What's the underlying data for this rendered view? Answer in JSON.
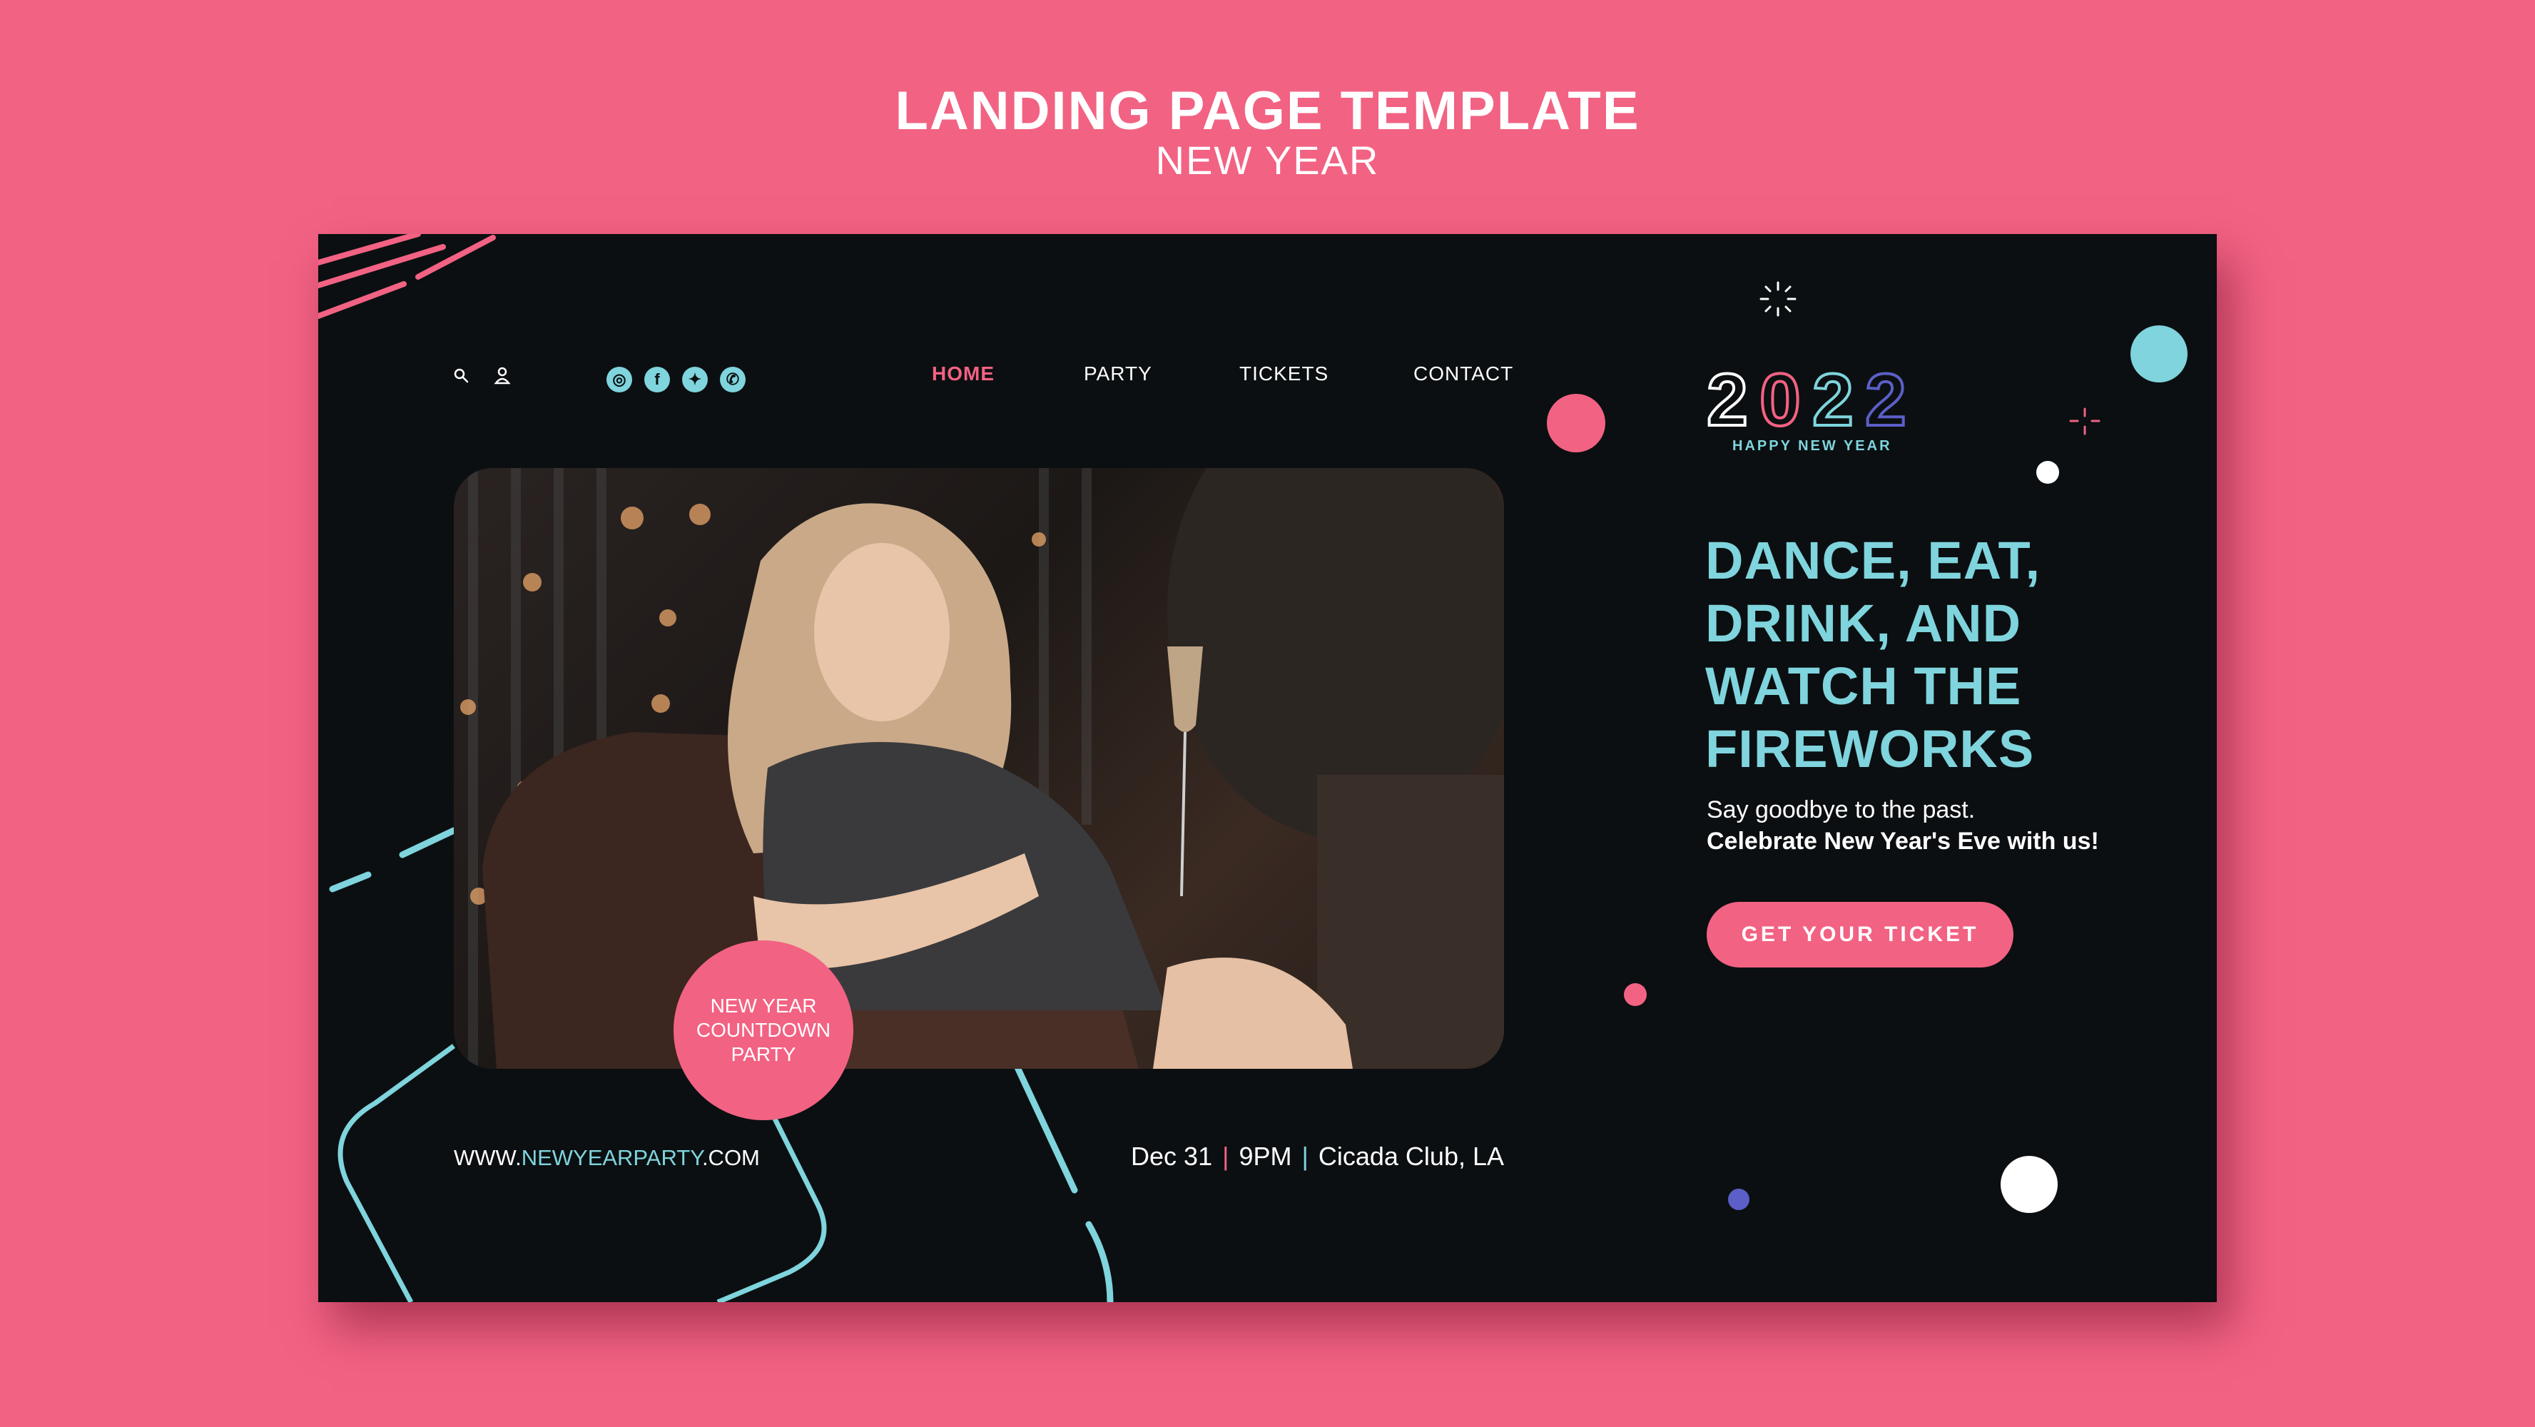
{
  "header": {
    "title": "LANDING PAGE TEMPLATE",
    "subtitle": "NEW YEAR"
  },
  "nav": {
    "icons": [
      "search-icon",
      "user-icon"
    ],
    "social": [
      {
        "name": "instagram-icon",
        "glyph": "◎"
      },
      {
        "name": "facebook-icon",
        "glyph": "f"
      },
      {
        "name": "twitter-icon",
        "glyph": "✦"
      },
      {
        "name": "whatsapp-icon",
        "glyph": "✆"
      }
    ],
    "links": [
      {
        "label": "HOME",
        "active": true
      },
      {
        "label": "PARTY",
        "active": false
      },
      {
        "label": "TICKETS",
        "active": false
      },
      {
        "label": "CONTACT",
        "active": false
      }
    ]
  },
  "photo": {
    "badge_line1": "NEW YEAR",
    "badge_line2": "COUNTDOWN",
    "badge_line3": "PARTY"
  },
  "footer": {
    "url_prefix": "WWW.",
    "url_highlight": "NEWYEARPARTY",
    "url_suffix": ".COM",
    "date": "Dec 31",
    "time": "9PM",
    "venue": "Cicada Club, LA"
  },
  "hero": {
    "year_digits": [
      "2",
      "0",
      "2",
      "2"
    ],
    "year_caption": "HAPPY NEW YEAR",
    "headline_lines": [
      "DANCE, EAT,",
      "DRINK, AND",
      "WATCH THE",
      "FIREWORKS"
    ],
    "tagline1": "Say goodbye to the past.",
    "tagline2": "Celebrate New Year's Eve with us!",
    "cta_label": "GET YOUR TICKET"
  },
  "colors": {
    "background": "#f26283",
    "card": "#0b0f11",
    "accent_pink": "#f26283",
    "accent_cyan": "#7fd4dd",
    "accent_indigo": "#5b5fc7",
    "white": "#ffffff"
  }
}
